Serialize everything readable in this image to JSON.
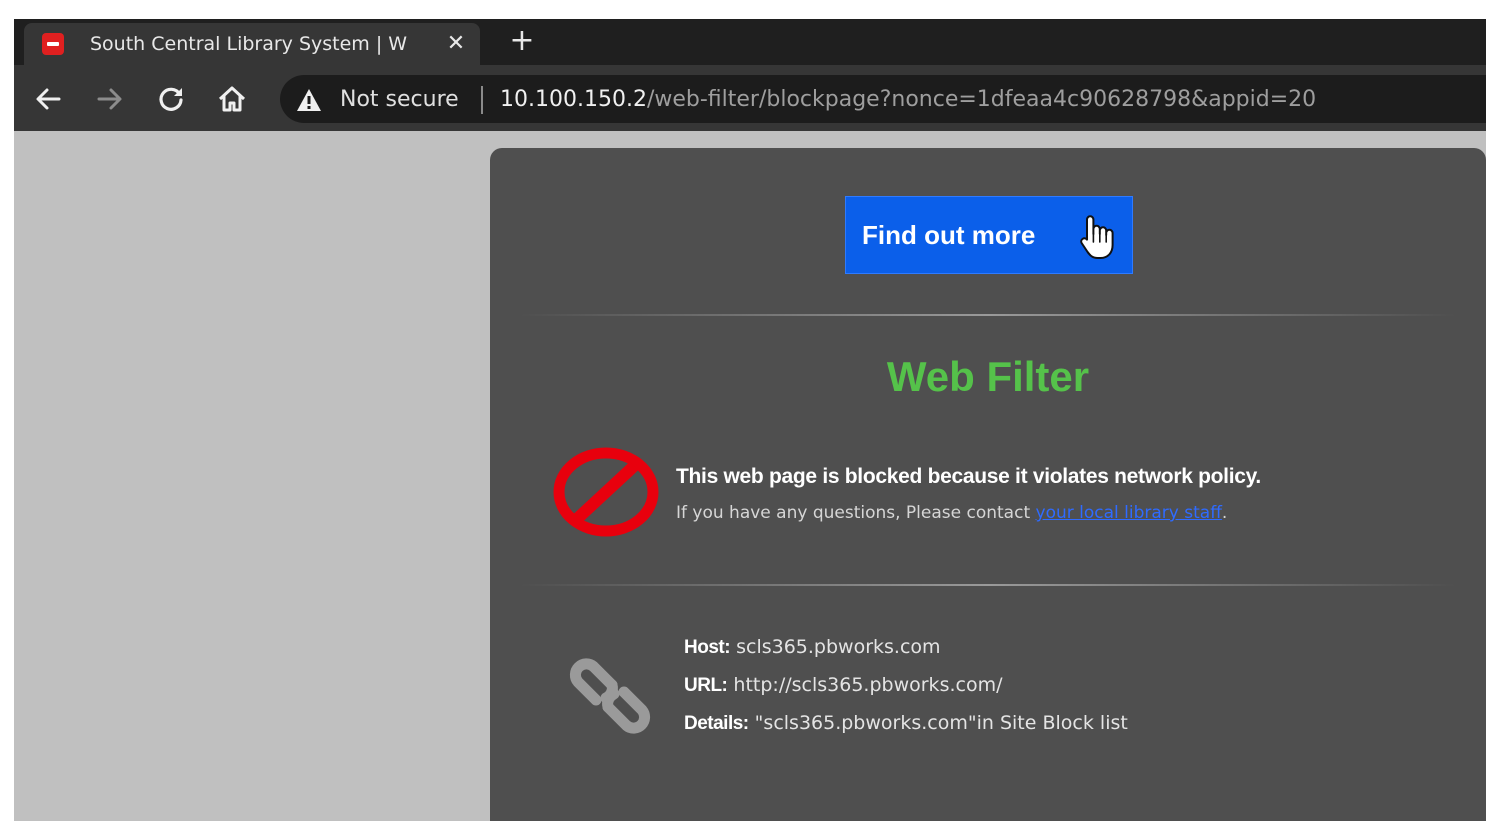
{
  "browser": {
    "tab": {
      "title": "South Central Library System | W"
    },
    "omnibox": {
      "security_label": "Not secure",
      "url_host": "10.100.150.2",
      "url_path": "/web-filter/blockpage?nonce=1dfeaa4c90628798&appid=20"
    }
  },
  "page": {
    "find_button_label": "Find out more",
    "title": "Web Filter",
    "blocked_message": "This web page is blocked because it violates network policy.",
    "contact_prefix": "If you have any questions, Please contact ",
    "contact_link": "your local library staff",
    "contact_suffix": ".",
    "details": [
      {
        "label": "Host:",
        "value": " scls365.pbworks.com"
      },
      {
        "label": "URL:",
        "value": " http://scls365.pbworks.com/"
      },
      {
        "label": "Details:",
        "value": " \"scls365.pbworks.com\"in Site Block list"
      }
    ]
  },
  "colors": {
    "title_green": "#55c24a",
    "button_blue": "#0b5fea",
    "block_red": "#e8000d",
    "link_blue": "#2f6bff"
  },
  "icons": [
    "blocked-favicon",
    "close-icon",
    "plus-icon",
    "back-arrow-icon",
    "forward-arrow-icon",
    "reload-icon",
    "home-icon",
    "warning-icon",
    "pointer-hand-icon",
    "prohibited-icon",
    "chain-link-icon"
  ]
}
